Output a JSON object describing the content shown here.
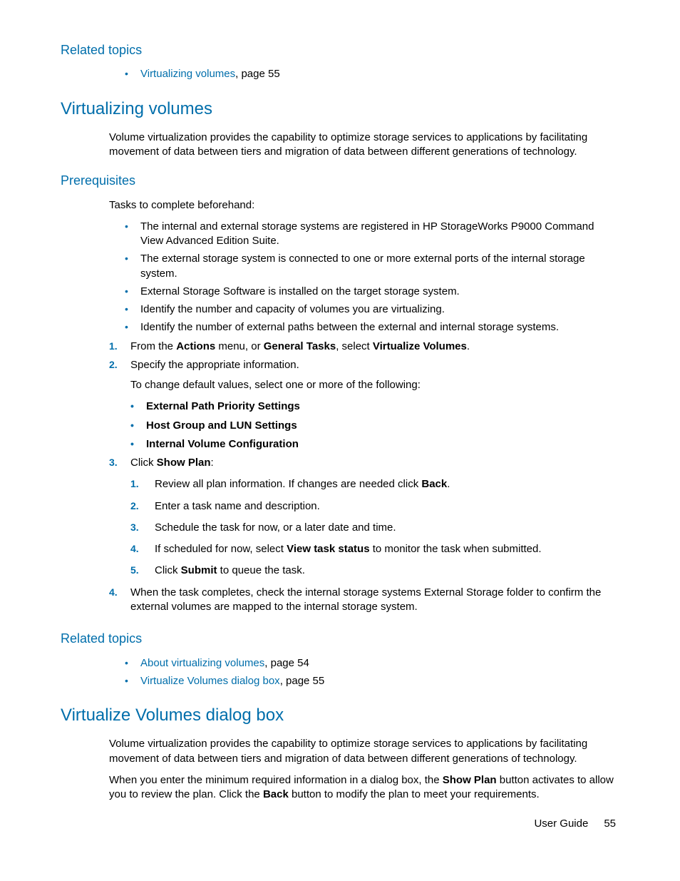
{
  "related1": {
    "heading": "Related topics",
    "item_link": "Virtualizing volumes",
    "item_suffix": ", page 55"
  },
  "virt": {
    "heading": "Virtualizing volumes",
    "intro": "Volume virtualization provides the capability to optimize storage services to applications by facilitating movement of data between tiers and migration of data between different generations of technology."
  },
  "prereq": {
    "heading": "Prerequisites",
    "intro": "Tasks to complete beforehand:",
    "b1": "The internal and external storage systems are registered in HP StorageWorks P9000 Command View Advanced Edition Suite.",
    "b2": "The external storage system is connected to one or more external ports of the internal storage system.",
    "b3": "External Storage Software is installed on the target storage system.",
    "b4": "Identify the number and capacity of volumes you are virtualizing.",
    "b5": "Identify the number of external paths between the external and internal storage systems.",
    "s1_pre": "From the ",
    "s1_b1": "Actions",
    "s1_mid1": " menu, or ",
    "s1_b2": "General Tasks",
    "s1_mid2": ", select ",
    "s1_b3": "Virtualize Volumes",
    "s1_end": ".",
    "s2": "Specify the appropriate information.",
    "s2_note": "To change default values, select one or more of the following:",
    "s2_sub1": "External Path Priority Settings",
    "s2_sub2": "Host Group and LUN Settings",
    "s2_sub3": "Internal Volume Configuration",
    "s3_pre": "Click ",
    "s3_b": "Show Plan",
    "s3_end": ":",
    "s3_sub1_pre": "Review all plan information. If changes are needed click ",
    "s3_sub1_b": "Back",
    "s3_sub1_end": ".",
    "s3_sub2": "Enter a task name and description.",
    "s3_sub3": "Schedule the task for now, or a later date and time.",
    "s3_sub4_pre": "If scheduled for now, select ",
    "s3_sub4_b": "View task status",
    "s3_sub4_end": " to monitor the task when submitted.",
    "s3_sub5_pre": "Click ",
    "s3_sub5_b": "Submit",
    "s3_sub5_end": " to queue the task.",
    "s4": "When the task completes, check the internal storage systems External Storage folder to confirm the external volumes are mapped to the internal storage system."
  },
  "related2": {
    "heading": "Related topics",
    "r1_link": "About virtualizing volumes",
    "r1_suffix": ", page 54",
    "r2_link": "Virtualize Volumes dialog box",
    "r2_suffix": ", page 55"
  },
  "dialog": {
    "heading": "Virtualize Volumes dialog box",
    "p1": "Volume virtualization provides the capability to optimize storage services to applications by facilitating movement of data between tiers and migration of data between different generations of technology.",
    "p2_pre": "When you enter the minimum required information in a dialog box, the ",
    "p2_b1": "Show Plan",
    "p2_mid": " button activates to allow you to review the plan. Click the ",
    "p2_b2": "Back",
    "p2_end": " button to modify the plan to meet your requirements."
  },
  "footer": {
    "label": "User Guide",
    "page": "55"
  }
}
